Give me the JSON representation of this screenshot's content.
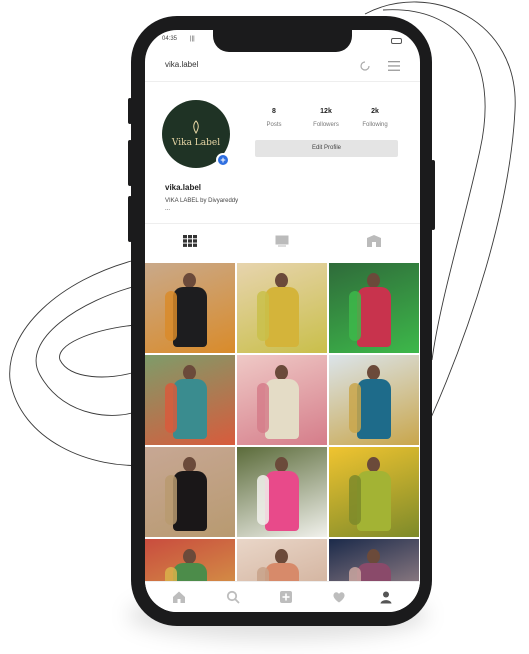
{
  "status": {
    "time": "04:35",
    "signal": "|||"
  },
  "header": {
    "username": "vika.label"
  },
  "profile": {
    "avatar_text": "Vika Label",
    "stats": [
      {
        "value": "8",
        "label": "Posts"
      },
      {
        "value": "12k",
        "label": "Followers"
      },
      {
        "value": "2k",
        "label": "Following"
      }
    ],
    "edit_button": "Edit Profile",
    "name": "vika.label",
    "bio": "VIKA LABEL by Divyareddy",
    "bio_more": "..."
  },
  "tabs": [
    {
      "icon": "grid-icon"
    },
    {
      "icon": "reels-icon"
    },
    {
      "icon": "tagged-icon"
    }
  ],
  "posts": [
    {
      "bg": "#c9a98a",
      "dress": "#1d1d1f",
      "accent": "#d98b2a"
    },
    {
      "bg": "#e7d4ae",
      "dress": "#d4b43a",
      "accent": "#c9bf4a"
    },
    {
      "bg": "#2f6b3a",
      "dress": "#c8334d",
      "accent": "#3db84a"
    },
    {
      "bg": "#7e9c6a",
      "dress": "#3a8c8f",
      "accent": "#d85b3c"
    },
    {
      "bg": "#efc9c6",
      "dress": "#e4dcc6",
      "accent": "#d57d8a"
    },
    {
      "bg": "#dbe4ea",
      "dress": "#1e6b8a",
      "accent": "#c9a64b"
    },
    {
      "bg": "#c7a794",
      "dress": "#1a1718",
      "accent": "#b89a70"
    },
    {
      "bg": "#5b6b3a",
      "dress": "#e84a8a",
      "accent": "#f1f1ec"
    },
    {
      "bg": "#f0c430",
      "dress": "#a3b334",
      "accent": "#7d8a2a"
    },
    {
      "bg": "#c94c3e",
      "dress": "#4c8c4a",
      "accent": "#d9b24a"
    },
    {
      "bg": "#e9d6c8",
      "dress": "#d78a6a",
      "accent": "#c8a28a"
    },
    {
      "bg": "#1b2a4a",
      "dress": "#8a4a6a",
      "accent": "#caa6a0"
    }
  ],
  "bottom_nav": [
    {
      "icon": "home-icon"
    },
    {
      "icon": "search-icon"
    },
    {
      "icon": "add-post-icon"
    },
    {
      "icon": "heart-icon"
    },
    {
      "icon": "profile-icon"
    }
  ],
  "colors": {
    "avatar_bg": "#1f3325",
    "accent_blue": "#2f6fe0",
    "phone_frame": "#1b1b1c"
  }
}
